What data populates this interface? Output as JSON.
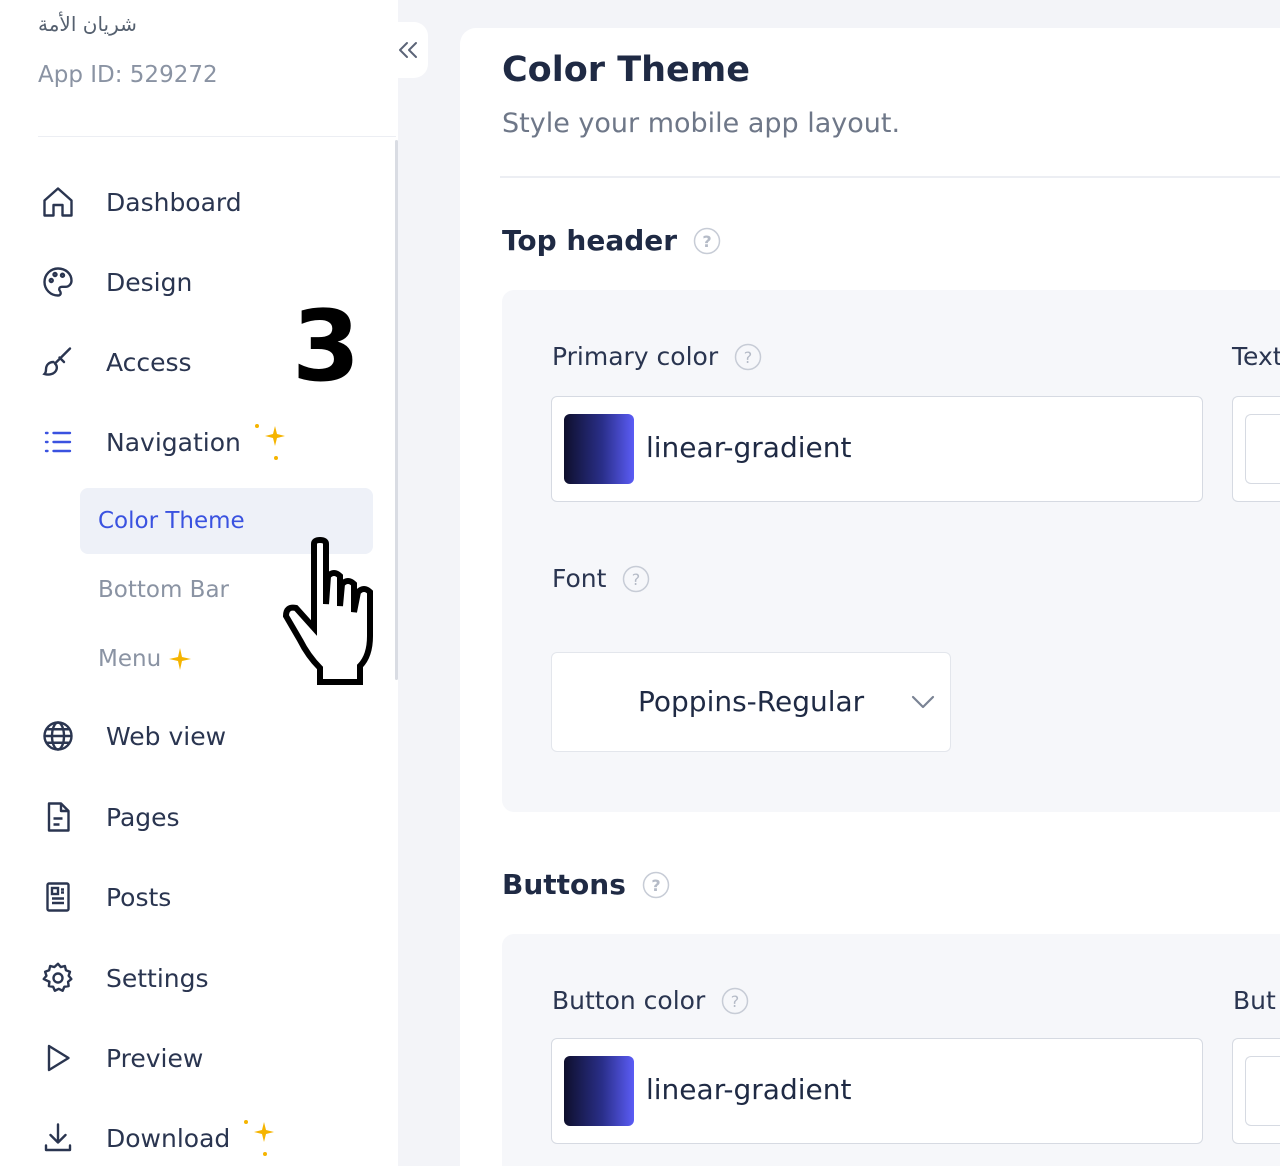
{
  "sidebar": {
    "app_name": "شريان الأمة",
    "app_id": "App ID: 529272",
    "items": [
      {
        "label": "Dashboard",
        "icon": "home-icon"
      },
      {
        "label": "Design",
        "icon": "palette-icon"
      },
      {
        "label": "Access",
        "icon": "brush-icon"
      },
      {
        "label": "Navigation",
        "icon": "list-icon"
      },
      {
        "label": "Web view",
        "icon": "globe-icon"
      },
      {
        "label": "Pages",
        "icon": "page-icon"
      },
      {
        "label": "Posts",
        "icon": "newspaper-icon"
      },
      {
        "label": "Settings",
        "icon": "gear-icon"
      },
      {
        "label": "Preview",
        "icon": "play-icon"
      },
      {
        "label": "Download",
        "icon": "download-icon"
      }
    ],
    "sub_items": [
      {
        "label": "Color Theme",
        "active": true
      },
      {
        "label": "Bottom Bar",
        "active": false
      },
      {
        "label": "Menu",
        "active": false
      }
    ]
  },
  "step_badge": "3",
  "main": {
    "title": "Color Theme",
    "subtitle": "Style your mobile app layout.",
    "sections": [
      {
        "title": "Top header",
        "fields": {
          "primary_color_label": "Primary color",
          "primary_color_value": "linear-gradient",
          "text_color_label": "Text",
          "font_label": "Font",
          "font_value": "Poppins-Regular"
        }
      },
      {
        "title": "Buttons",
        "fields": {
          "button_color_label": "Button color",
          "button_color_value": "linear-gradient",
          "button_text_label": "But"
        }
      }
    ]
  },
  "colors": {
    "accent": "#3a52e0",
    "sparkle": "#f5b400",
    "gradient_start": "#0e0f2c",
    "gradient_end": "#5b5cf6"
  }
}
